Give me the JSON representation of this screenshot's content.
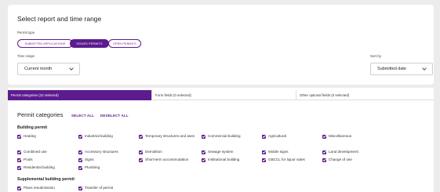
{
  "header": {
    "title": "Select report and time range",
    "permit_type_label": "Permit type",
    "time_range_label": "Time range",
    "sort_by_label": "Sort by"
  },
  "permit_types": [
    {
      "label": "SUBMITTED APPLICATIONS",
      "active": false
    },
    {
      "label": "ISSUED PERMITS",
      "active": true
    },
    {
      "label": "OPEN PERMITS",
      "active": false
    }
  ],
  "time_range": {
    "value": "Current month"
  },
  "sort_by": {
    "value": "Submitted date"
  },
  "tabs": [
    {
      "label": "Permit categories (22 selected)"
    },
    {
      "label": "Form fields (0 selected)"
    },
    {
      "label": "Other optional fields (0 selected)"
    }
  ],
  "permit_categories": {
    "title": "Permit categories",
    "select_all": "SELECT ALL",
    "deselect_all": "DESELECT ALL"
  },
  "groups": [
    {
      "title": "Building permit",
      "items": [
        {
          "label": "Heating",
          "checked": true
        },
        {
          "label": "Industrial building",
          "checked": true
        },
        {
          "label": "Temporary structures and ases",
          "checked": true
        },
        {
          "label": "Commercial building",
          "checked": true
        },
        {
          "label": "Agricultural",
          "checked": true
        },
        {
          "label": "Miscellaneous",
          "checked": true
        },
        {
          "label": "Combined use",
          "checked": true
        },
        {
          "label": "Accessory structures",
          "checked": true
        },
        {
          "label": "Demolition",
          "checked": true
        },
        {
          "label": "Sewage system",
          "checked": true
        },
        {
          "label": "Mobile signs",
          "checked": true
        },
        {
          "label": "Land development",
          "checked": true
        },
        {
          "label": "Pools",
          "checked": true
        },
        {
          "label": "Signs",
          "checked": true
        },
        {
          "label": "Short-term accommodation",
          "checked": true
        },
        {
          "label": "Institutional building",
          "checked": true
        },
        {
          "label": "GBCCL for liquor sales",
          "checked": true
        },
        {
          "label": "Change of use",
          "checked": true
        },
        {
          "label": "Residential building",
          "checked": true
        },
        {
          "label": "Plumbing",
          "checked": true
        }
      ]
    },
    {
      "title": "Supplemental building permit",
      "items": [
        {
          "label": "Plans resubmission",
          "checked": true
        },
        {
          "label": "Transfer of permit",
          "checked": true
        }
      ]
    }
  ],
  "colors": {
    "accent": "#5c1b8e",
    "background": "#ececec",
    "card": "#ffffff"
  }
}
